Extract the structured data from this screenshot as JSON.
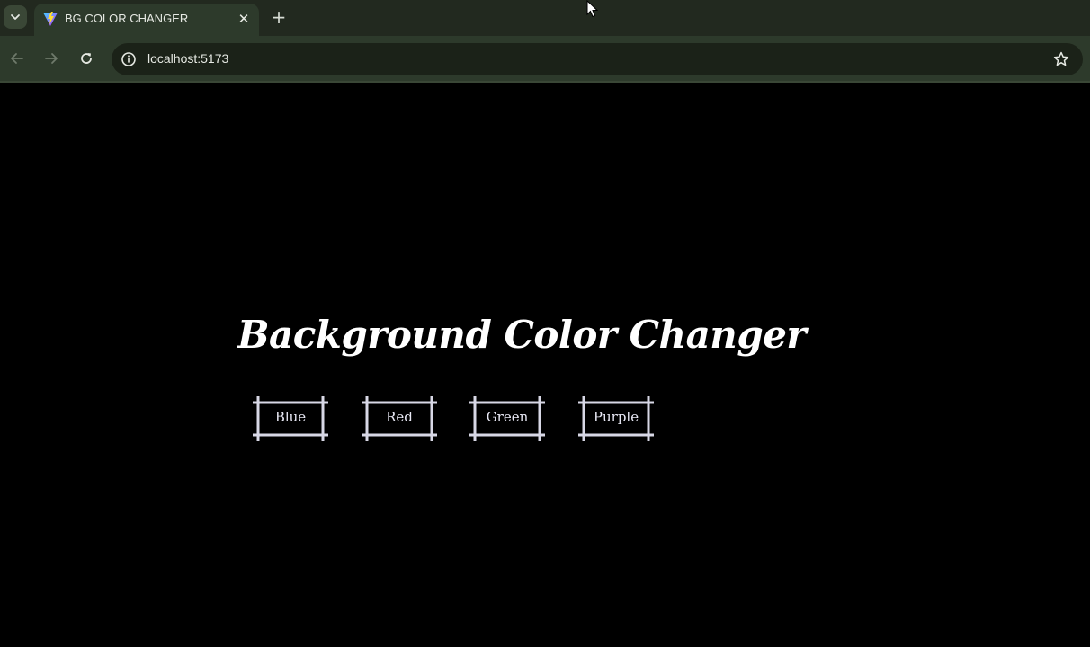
{
  "browser": {
    "tab_title": "BG COLOR CHANGER",
    "url": "localhost:5173",
    "tab_close_glyph": "✕",
    "new_tab_glyph": "+",
    "icons": {
      "tab_search": "chevron-down-icon",
      "favicon": "vite-favicon-icon",
      "back": "back-arrow-icon",
      "forward": "forward-arrow-icon",
      "reload": "reload-icon",
      "site_info": "info-icon",
      "bookmark": "star-icon"
    },
    "colors": {
      "frame": "#2d3a2b",
      "tab_strip": "#22291f",
      "omnibox": "#1b2218"
    }
  },
  "page": {
    "heading": "Background Color Changer",
    "background": "#000000",
    "buttons": [
      {
        "label": "Blue"
      },
      {
        "label": "Red"
      },
      {
        "label": "Green"
      },
      {
        "label": "Purple"
      }
    ]
  }
}
